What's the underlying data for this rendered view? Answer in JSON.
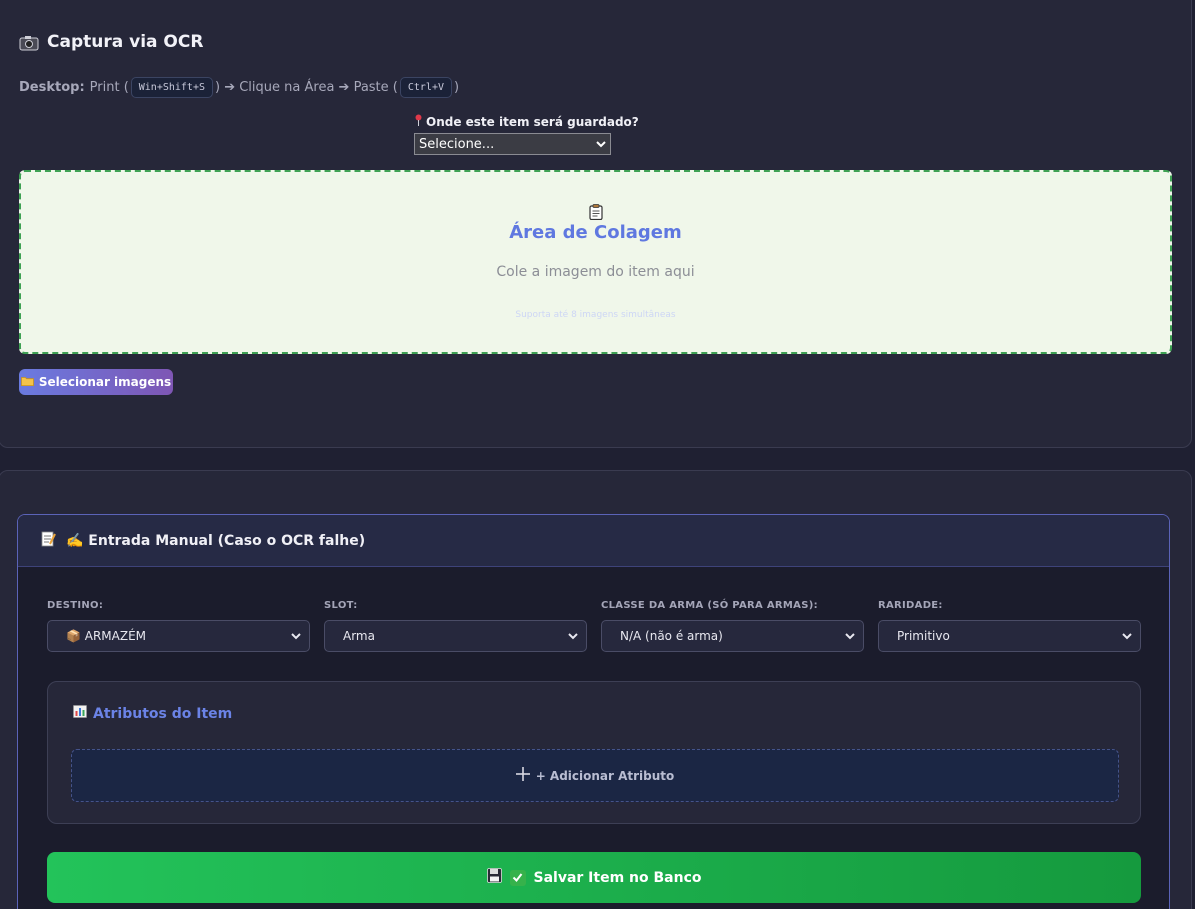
{
  "ocr": {
    "title": "Captura via OCR",
    "desktop_label": "Desktop:",
    "step_print": "Print (",
    "shortcut_capture": "Win+Shift+S",
    "step_click": ") ➔ Clique na Área ➔ Paste (",
    "shortcut_paste": "Ctrl+V",
    "step_end": ")",
    "store_label": "Onde este item será guardado?",
    "store_select_value": "Selecione...",
    "paste_title": "Área de Colagem",
    "paste_subtitle": "Cole a imagem do item aqui",
    "paste_hint": "Suporta até 8 imagens simultâneas",
    "select_images_button": "Selecionar imagens"
  },
  "manual": {
    "title": "✍️ Entrada Manual (Caso o OCR falhe)",
    "fields": [
      {
        "label": "DESTINO:",
        "value": "📦 ARMAZÉM"
      },
      {
        "label": "SLOT:",
        "value": "Arma"
      },
      {
        "label": "CLASSE DA ARMA (SÓ PARA ARMAS):",
        "value": "N/A (não é arma)"
      },
      {
        "label": "RARIDADE:",
        "value": "Primitivo"
      }
    ],
    "attributes_title": "Atributos do Item",
    "add_attribute_button": "+ Adicionar Atributo",
    "save_button": "Salvar Item no Banco"
  },
  "icons": {
    "camera": "camera-icon",
    "pin": "pin-icon",
    "clipboard": "clipboard-icon",
    "folder": "folder-icon",
    "memo": "memo-icon",
    "chart": "bar-chart-icon",
    "plus": "plus-icon",
    "floppy": "floppy-icon",
    "check": "check-icon"
  },
  "colors": {
    "accent_blue": "#5f78e0",
    "paste_bg": "#f0f7ea",
    "paste_border": "#3ea153",
    "save_green": "#23c35a"
  }
}
